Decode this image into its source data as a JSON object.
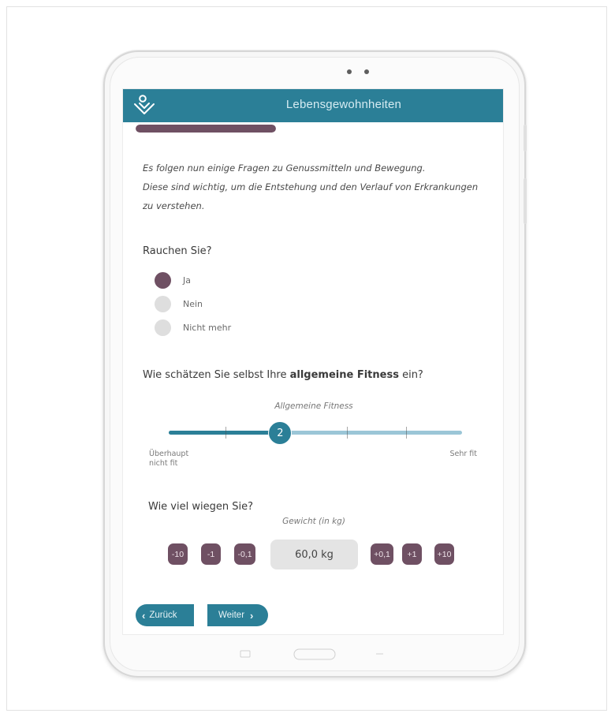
{
  "app": {
    "title": "Lebensgewohnheiten"
  },
  "progress": {
    "fraction": 0.2
  },
  "intro": {
    "lines": [
      "Es folgen nun einige Fragen zu Genussmitteln und Bewegung.",
      "Diese sind wichtig, um die Entstehung und den Verlauf von Erkrankungen zu verstehen."
    ]
  },
  "smoking": {
    "question": "Rauchen Sie?",
    "options": [
      "Ja",
      "Nein",
      "Nicht mehr"
    ],
    "selected": "Ja"
  },
  "fitness": {
    "question_prefix": "Wie schätzen Sie selbst Ihre ",
    "question_bold": "allgemeine Fitness",
    "question_suffix": " ein?",
    "slider_title": "Allgemeine Fitness",
    "value": "2",
    "min_label": "Überhaupt nicht fit",
    "max_label": "Sehr fit"
  },
  "weight": {
    "question": "Wie viel wiegen Sie?",
    "field_label": "Gewicht (in kg)",
    "value": "60,0 kg",
    "minus_10": "-10",
    "minus_1": "-1",
    "minus_01": "-0,1",
    "plus_01": "+0,1",
    "plus_1": "+1",
    "plus_10": "+10"
  },
  "nav": {
    "back": "Zurück",
    "next": "Weiter"
  },
  "colors": {
    "primary": "#2b7f97",
    "accent": "#6f5063",
    "inactive": "#dedede"
  },
  "icons": {
    "logo": "heart-outline-logo-icon",
    "back": "chevron-left-icon",
    "next": "chevron-right-icon",
    "recent": "recent-apps-icon",
    "home": "home-button-icon",
    "system_back": "back-icon"
  }
}
